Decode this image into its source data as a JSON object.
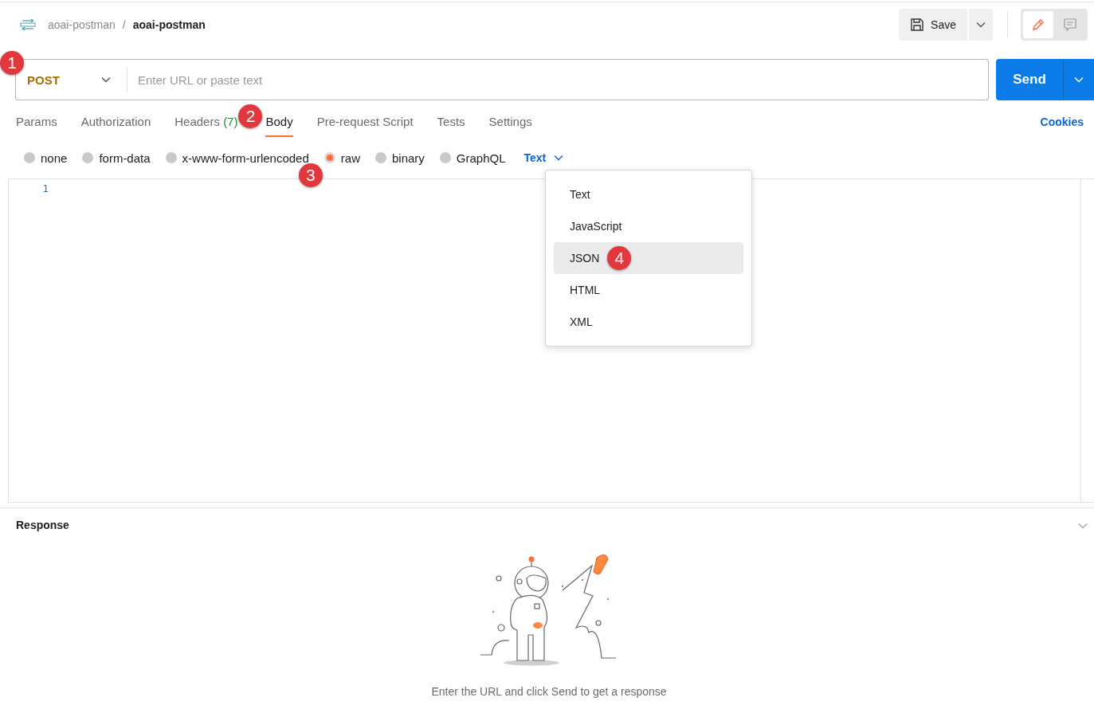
{
  "header": {
    "breadcrumb": [
      {
        "text": "aoai-postman"
      },
      {
        "text": "aoai-postman"
      }
    ],
    "separator": "/",
    "save_label": "Save"
  },
  "request": {
    "method": "POST",
    "method_callout": "1",
    "url_placeholder": "Enter URL or paste text",
    "send_label": "Send"
  },
  "tabs": [
    {
      "label": "Params",
      "selected": false
    },
    {
      "label": "Authorization",
      "selected": false
    },
    {
      "label": "Headers",
      "count": "(7)",
      "selected": false
    },
    {
      "label": "Body",
      "selected": true,
      "callout": "2"
    },
    {
      "label": "Pre-request Script",
      "selected": false
    },
    {
      "label": "Tests",
      "selected": false
    },
    {
      "label": "Settings",
      "selected": false
    }
  ],
  "cookies_link": "Cookies",
  "body_types": [
    {
      "label": "none",
      "selected": false
    },
    {
      "label": "form-data",
      "selected": false
    },
    {
      "label": "x-www-form-urlencoded",
      "selected": false
    },
    {
      "label": "raw",
      "selected": true,
      "callout": "3"
    },
    {
      "label": "binary",
      "selected": false
    },
    {
      "label": "GraphQL",
      "selected": false
    }
  ],
  "language": {
    "value": "Text",
    "menu": [
      {
        "label": "Text",
        "highlighted": false
      },
      {
        "label": "JavaScript",
        "highlighted": false
      },
      {
        "label": "JSON",
        "highlighted": true,
        "callout": "4"
      },
      {
        "label": "HTML",
        "highlighted": false
      },
      {
        "label": "XML",
        "highlighted": false
      }
    ]
  },
  "editor": {
    "line_numbers": [
      "1"
    ]
  },
  "response": {
    "title": "Response",
    "empty_message": "Enter the URL and click Send to get a response"
  }
}
